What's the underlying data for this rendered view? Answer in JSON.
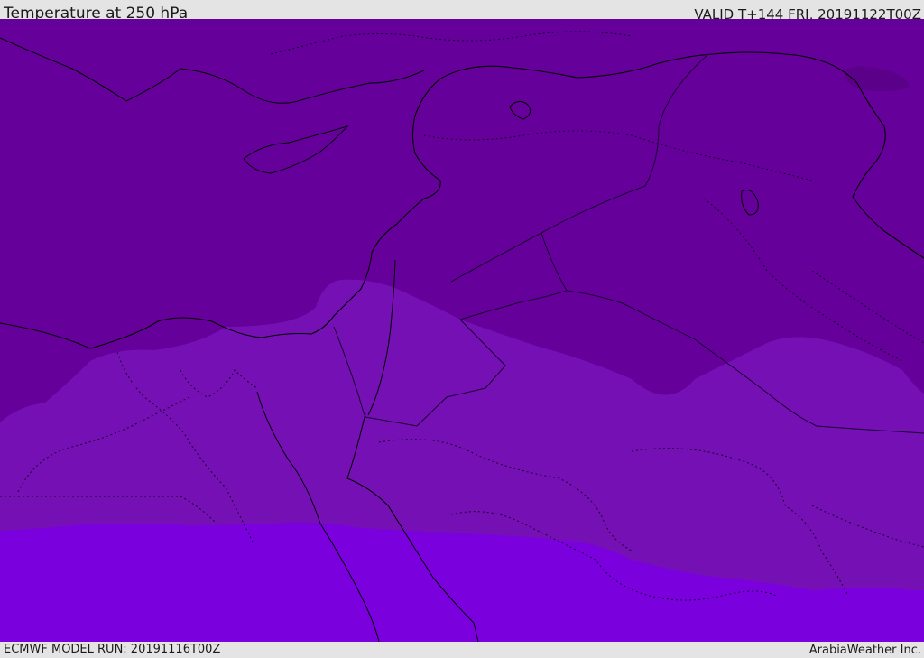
{
  "header": {
    "title": "Temperature at 250 hPa",
    "valid": "VALID T+144 FRI, 20191122T00Z"
  },
  "footer": {
    "model_run": "ECMWF MODEL RUN: 20191116T00Z",
    "credit": "ArabiaWeather Inc."
  },
  "map": {
    "colors": {
      "band_cold": "#66009a",
      "band_colder_pocket": "#5b0089",
      "band_mid": "#7510b4",
      "band_warm": "#7a00de",
      "coastline": "#000000",
      "borders": "#1a0030"
    }
  }
}
